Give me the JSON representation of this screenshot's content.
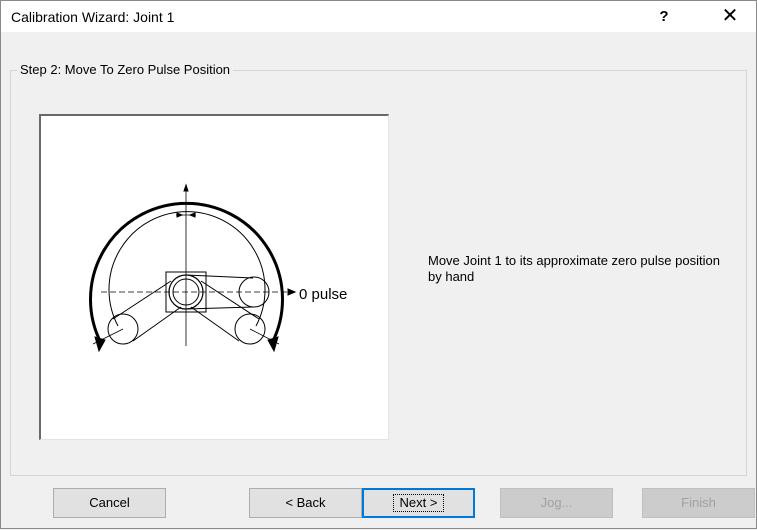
{
  "window": {
    "title": "Calibration Wizard: Joint 1",
    "help_label": "?",
    "close_label": "✕"
  },
  "step": {
    "heading": "Step 2: Move To Zero Pulse Position",
    "instruction": "Move Joint 1 to its approximate zero pulse position by hand",
    "diagram_label": "0 pulse"
  },
  "buttons": {
    "cancel": "Cancel",
    "back": "< Back",
    "next": "Next >",
    "jog": "Jog...",
    "finish": "Finish"
  },
  "state": {
    "jog_enabled": false,
    "finish_enabled": false,
    "default_button": "Next >"
  }
}
